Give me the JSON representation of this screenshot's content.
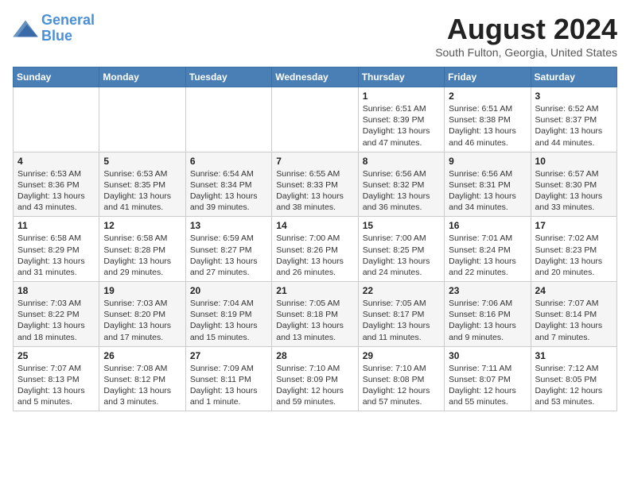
{
  "header": {
    "logo_line1": "General",
    "logo_line2": "Blue",
    "month": "August 2024",
    "location": "South Fulton, Georgia, United States"
  },
  "weekdays": [
    "Sunday",
    "Monday",
    "Tuesday",
    "Wednesday",
    "Thursday",
    "Friday",
    "Saturday"
  ],
  "weeks": [
    [
      {
        "day": "",
        "sunrise": "",
        "sunset": "",
        "daylight": ""
      },
      {
        "day": "",
        "sunrise": "",
        "sunset": "",
        "daylight": ""
      },
      {
        "day": "",
        "sunrise": "",
        "sunset": "",
        "daylight": ""
      },
      {
        "day": "",
        "sunrise": "",
        "sunset": "",
        "daylight": ""
      },
      {
        "day": "1",
        "sunrise": "6:51 AM",
        "sunset": "8:39 PM",
        "daylight": "13 hours and 47 minutes."
      },
      {
        "day": "2",
        "sunrise": "6:51 AM",
        "sunset": "8:38 PM",
        "daylight": "13 hours and 46 minutes."
      },
      {
        "day": "3",
        "sunrise": "6:52 AM",
        "sunset": "8:37 PM",
        "daylight": "13 hours and 44 minutes."
      }
    ],
    [
      {
        "day": "4",
        "sunrise": "6:53 AM",
        "sunset": "8:36 PM",
        "daylight": "13 hours and 43 minutes."
      },
      {
        "day": "5",
        "sunrise": "6:53 AM",
        "sunset": "8:35 PM",
        "daylight": "13 hours and 41 minutes."
      },
      {
        "day": "6",
        "sunrise": "6:54 AM",
        "sunset": "8:34 PM",
        "daylight": "13 hours and 39 minutes."
      },
      {
        "day": "7",
        "sunrise": "6:55 AM",
        "sunset": "8:33 PM",
        "daylight": "13 hours and 38 minutes."
      },
      {
        "day": "8",
        "sunrise": "6:56 AM",
        "sunset": "8:32 PM",
        "daylight": "13 hours and 36 minutes."
      },
      {
        "day": "9",
        "sunrise": "6:56 AM",
        "sunset": "8:31 PM",
        "daylight": "13 hours and 34 minutes."
      },
      {
        "day": "10",
        "sunrise": "6:57 AM",
        "sunset": "8:30 PM",
        "daylight": "13 hours and 33 minutes."
      }
    ],
    [
      {
        "day": "11",
        "sunrise": "6:58 AM",
        "sunset": "8:29 PM",
        "daylight": "13 hours and 31 minutes."
      },
      {
        "day": "12",
        "sunrise": "6:58 AM",
        "sunset": "8:28 PM",
        "daylight": "13 hours and 29 minutes."
      },
      {
        "day": "13",
        "sunrise": "6:59 AM",
        "sunset": "8:27 PM",
        "daylight": "13 hours and 27 minutes."
      },
      {
        "day": "14",
        "sunrise": "7:00 AM",
        "sunset": "8:26 PM",
        "daylight": "13 hours and 26 minutes."
      },
      {
        "day": "15",
        "sunrise": "7:00 AM",
        "sunset": "8:25 PM",
        "daylight": "13 hours and 24 minutes."
      },
      {
        "day": "16",
        "sunrise": "7:01 AM",
        "sunset": "8:24 PM",
        "daylight": "13 hours and 22 minutes."
      },
      {
        "day": "17",
        "sunrise": "7:02 AM",
        "sunset": "8:23 PM",
        "daylight": "13 hours and 20 minutes."
      }
    ],
    [
      {
        "day": "18",
        "sunrise": "7:03 AM",
        "sunset": "8:22 PM",
        "daylight": "13 hours and 18 minutes."
      },
      {
        "day": "19",
        "sunrise": "7:03 AM",
        "sunset": "8:20 PM",
        "daylight": "13 hours and 17 minutes."
      },
      {
        "day": "20",
        "sunrise": "7:04 AM",
        "sunset": "8:19 PM",
        "daylight": "13 hours and 15 minutes."
      },
      {
        "day": "21",
        "sunrise": "7:05 AM",
        "sunset": "8:18 PM",
        "daylight": "13 hours and 13 minutes."
      },
      {
        "day": "22",
        "sunrise": "7:05 AM",
        "sunset": "8:17 PM",
        "daylight": "13 hours and 11 minutes."
      },
      {
        "day": "23",
        "sunrise": "7:06 AM",
        "sunset": "8:16 PM",
        "daylight": "13 hours and 9 minutes."
      },
      {
        "day": "24",
        "sunrise": "7:07 AM",
        "sunset": "8:14 PM",
        "daylight": "13 hours and 7 minutes."
      }
    ],
    [
      {
        "day": "25",
        "sunrise": "7:07 AM",
        "sunset": "8:13 PM",
        "daylight": "13 hours and 5 minutes."
      },
      {
        "day": "26",
        "sunrise": "7:08 AM",
        "sunset": "8:12 PM",
        "daylight": "13 hours and 3 minutes."
      },
      {
        "day": "27",
        "sunrise": "7:09 AM",
        "sunset": "8:11 PM",
        "daylight": "13 hours and 1 minute."
      },
      {
        "day": "28",
        "sunrise": "7:10 AM",
        "sunset": "8:09 PM",
        "daylight": "12 hours and 59 minutes."
      },
      {
        "day": "29",
        "sunrise": "7:10 AM",
        "sunset": "8:08 PM",
        "daylight": "12 hours and 57 minutes."
      },
      {
        "day": "30",
        "sunrise": "7:11 AM",
        "sunset": "8:07 PM",
        "daylight": "12 hours and 55 minutes."
      },
      {
        "day": "31",
        "sunrise": "7:12 AM",
        "sunset": "8:05 PM",
        "daylight": "12 hours and 53 minutes."
      }
    ]
  ]
}
